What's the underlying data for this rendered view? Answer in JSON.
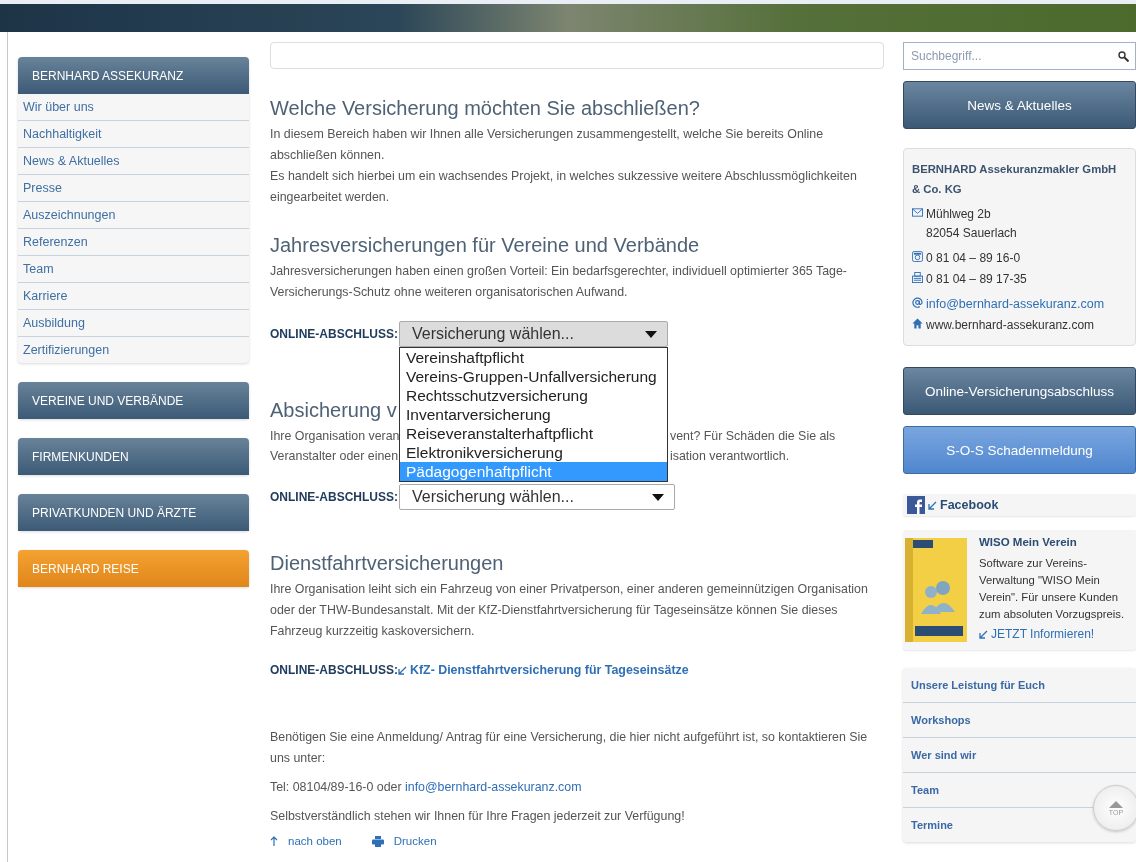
{
  "sidebar": {
    "sections": [
      {
        "title": "BERNHARD ASSEKURANZ",
        "kind": "dark",
        "items": [
          "Wir über uns",
          "Nachhaltigkeit",
          "News & Aktuelles",
          "Presse",
          "Auszeichnungen",
          "Referenzen",
          "Team",
          "Karriere",
          "Ausbildung",
          "Zertifizierungen"
        ]
      },
      {
        "title": "VEREINE UND VERBÄNDE",
        "kind": "dark"
      },
      {
        "title": "FIRMENKUNDEN",
        "kind": "dark"
      },
      {
        "title": "PRIVATKUNDEN UND ÄRZTE",
        "kind": "dark"
      },
      {
        "title": "BERNHARD REISE",
        "kind": "accent"
      }
    ]
  },
  "main": {
    "sections": [
      {
        "kind": "text",
        "heading": "Welche Versicherung möchten Sie abschließen?",
        "paragraphs": [
          "In diesem Bereich haben wir Ihnen alle Versicherungen zusammengestellt, welche Sie bereits Online abschließen können.",
          "Es handelt sich hierbei um ein wachsendes Projekt, in welches sukzessive weitere Abschlussmöglichkeiten eingearbeitet werden."
        ]
      },
      {
        "kind": "select",
        "heading": "Jahresversicherungen für Vereine und Verbände",
        "paragraphs": [
          "Jahresversicherungen haben einen großen Vorteil: Ein bedarfsgerechter, individuell optimierter 365 Tage-Versicherungs-Schutz ohne weiteren organisatorischen Aufwand."
        ],
        "order": {
          "label": "ONLINE-ABSCHLUSS:",
          "value": "Versicherung wählen...",
          "open": true,
          "options": [
            {
              "label": "Vereinshaftpflicht",
              "selected": false
            },
            {
              "label": "Vereins-Gruppen-Unfallversicherung",
              "selected": false
            },
            {
              "label": "Rechtsschutzversicherung",
              "selected": false
            },
            {
              "label": "Inventarversicherung",
              "selected": false
            },
            {
              "label": "Reiseveranstalterhaftpflicht",
              "selected": false
            },
            {
              "label": "Elektronikversicherung",
              "selected": false
            },
            {
              "label": "Pädagogenhaftpflicht",
              "selected": true
            }
          ]
        }
      },
      {
        "kind": "covered",
        "heading": "Absicherung v",
        "lines": [
          {
            "left": "Ihre Organisation veran",
            "right": "vent? Für Schäden die Sie als"
          },
          {
            "left": "Veranstalter oder einen",
            "right": "isation verantwortlich."
          }
        ],
        "order": {
          "label": "ONLINE-ABSCHLUSS:",
          "value": "Versicherung wählen...",
          "open": false
        }
      },
      {
        "kind": "link",
        "heading": "Dienstfahrtversicherungen",
        "paragraphs": [
          "Ihre Organisation leiht sich ein Fahrzeug von einer Privatperson, einer anderen gemeinnützigen Organisation oder der THW-Bundesanstalt. Mit der KfZ-Dienstfahrtversicherung für Tageseinsätze können Sie dieses Fahrzeug kurzzeitig kaskoversichern."
        ],
        "order": {
          "label": "ONLINE-ABSCHLUSS:",
          "link": "KfZ- Dienstfahrtversicherung für Tageseinsätze"
        }
      }
    ],
    "contact": {
      "text": "Benötigen Sie eine Anmeldung/ Antrag für eine Versicherung, die hier nicht aufgeführt ist, so kontaktieren Sie uns unter:",
      "phone": "Tel: 08104/89-16-0 oder",
      "email": "info@bernhard-assekuranz.com",
      "closing": "Selbstverständlich stehen wir Ihnen für Ihre Fragen jederzeit zur Verfügung!"
    },
    "footer_links": [
      {
        "kind": "up",
        "label": "nach oben"
      },
      {
        "kind": "print",
        "label": "Drucken"
      }
    ]
  },
  "right": {
    "search": {
      "placeholder": "Suchbegriff..."
    },
    "news_button": {
      "label": "News & Aktuelles",
      "kind": "dark"
    },
    "contact_card": {
      "company": "BERNHARD Assekuranzmakler GmbH & Co. KG",
      "entries": [
        {
          "kind": "mail",
          "text": "Mühlweg 2b",
          "text2": "82054 Sauerlach"
        },
        {
          "kind": "phone",
          "text": "0 81 04 – 89 16-0"
        },
        {
          "kind": "fax",
          "text": "0 81 04 – 89 17-35"
        },
        {
          "kind": "email",
          "text": "info@bernhard-assekuranz.com"
        },
        {
          "kind": "home",
          "text": "www.bernhard-assekuranz.com"
        }
      ]
    },
    "buttons": [
      {
        "label": "Online-Versicherungsabschluss",
        "kind": "dark"
      },
      {
        "label": "S-O-S Schadenmeldung",
        "kind": "light"
      }
    ],
    "facebook": {
      "label": "Facebook"
    },
    "promo": {
      "title": "WISO Mein Verein",
      "text": "Software zur Vereins-Verwaltung \"WISO Mein Verein\". Für unsere Kunden zum absoluten Vorzugspreis.",
      "link": "JETZT Informieren!"
    },
    "links": [
      "Unsere Leistung für Euch",
      "Workshops",
      "Wer sind wir",
      "Team",
      "Termine"
    ]
  },
  "top_button": {
    "label": "TOP"
  }
}
